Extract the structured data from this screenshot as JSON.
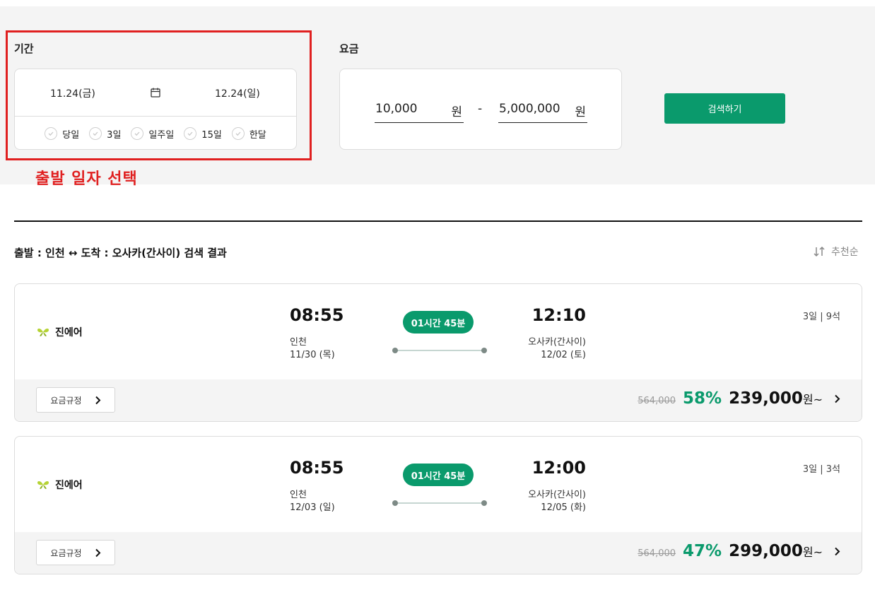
{
  "filter": {
    "period_label": "기간",
    "date_start": "11.24(금)",
    "date_end": "12.24(일)",
    "quick_options": [
      "당일",
      "3일",
      "일주일",
      "15일",
      "한달"
    ],
    "fare_label": "요금",
    "fare_min": "10,000",
    "fare_max": "5,000,000",
    "fare_unit": "원",
    "fare_separator": "-",
    "search_button": "검색하기"
  },
  "annotation": {
    "text": "출발 일자 선택",
    "color": "#e02020"
  },
  "results": {
    "title": "출발 : 인천 ↔ 도착 : 오사카(간사이) 검색 결과",
    "sort_label": "추천순"
  },
  "flights": [
    {
      "airline": "진에어",
      "dep_time": "08:55",
      "dep_city": "인천",
      "dep_date": "11/30 (목)",
      "duration": "01시간 45분",
      "arr_time": "12:10",
      "arr_city": "오사카(간사이)",
      "arr_date": "12/02 (토)",
      "seats": "3일 | 9석",
      "rule_button": "요금규정",
      "original_price": "564,000",
      "discount": "58%",
      "price": "239,000",
      "price_unit": "원~"
    },
    {
      "airline": "진에어",
      "dep_time": "08:55",
      "dep_city": "인천",
      "dep_date": "12/03 (일)",
      "duration": "01시간 45분",
      "arr_time": "12:00",
      "arr_city": "오사카(간사이)",
      "arr_date": "12/05 (화)",
      "seats": "3일 | 3석",
      "rule_button": "요금규정",
      "original_price": "564,000",
      "discount": "47%",
      "price": "299,000",
      "price_unit": "원~"
    }
  ],
  "colors": {
    "accent": "#0a9a6c",
    "airline_logo": "#b5d334",
    "highlight": "#e02020"
  }
}
